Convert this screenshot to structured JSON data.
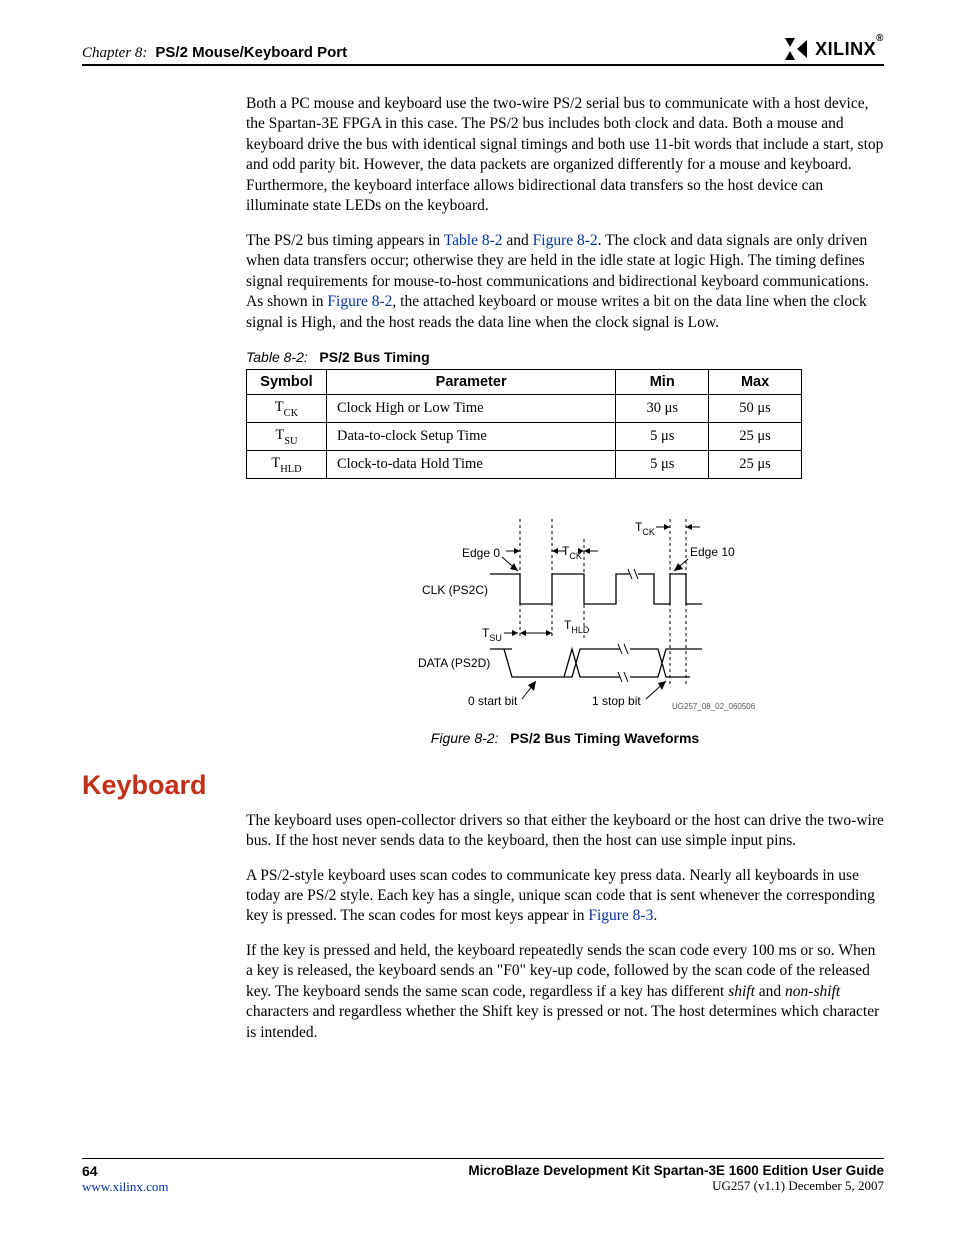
{
  "header": {
    "chapter_label": "Chapter 8:",
    "chapter_title": "PS/2 Mouse/Keyboard Port",
    "logo_text": "XILINX"
  },
  "para1": "Both a PC mouse and keyboard use the two-wire PS/2 serial bus to communicate with a host device, the Spartan-3E FPGA in this case. The PS/2 bus includes both clock and data. Both a mouse and keyboard drive the bus with identical signal timings and both use 11-bit words that include a start, stop and odd parity bit. However, the data packets are organized differently for a mouse and keyboard. Furthermore, the keyboard interface allows bidirectional data transfers so the host device can illuminate state LEDs on the keyboard.",
  "para2_a": "The PS/2 bus timing appears in ",
  "para2_xref1": "Table 8-2",
  "para2_b": " and ",
  "para2_xref2": "Figure 8-2",
  "para2_c": ". The clock and data signals are only driven when data transfers occur; otherwise they are held in the idle state at logic High. The timing defines signal requirements for mouse-to-host communications and bidirectional keyboard communications. As shown in ",
  "para2_xref3": "Figure 8-2",
  "para2_d": ", the attached keyboard or mouse writes a bit on the data line when the clock signal is High, and the host reads the data line when the clock signal is Low.",
  "table": {
    "caption_num": "Table 8-2:",
    "caption_title": "PS/2 Bus Timing",
    "headers": {
      "symbol": "Symbol",
      "parameter": "Parameter",
      "min": "Min",
      "max": "Max"
    },
    "rows": [
      {
        "sym_main": "T",
        "sym_sub": "CK",
        "param": "Clock High or Low Time",
        "min": "30 μs",
        "max": "50 μs"
      },
      {
        "sym_main": "T",
        "sym_sub": "SU",
        "param": "Data-to-clock Setup Time",
        "min": "5 μs",
        "max": "25 μs"
      },
      {
        "sym_main": "T",
        "sym_sub": "HLD",
        "param": "Clock-to-data Hold Time",
        "min": "5 μs",
        "max": "25 μs"
      }
    ]
  },
  "figure": {
    "caption_num": "Figure 8-2:",
    "caption_title": "PS/2 Bus Timing Waveforms",
    "labels": {
      "edge0": "Edge 0",
      "edge10": "Edge 10",
      "clk": "CLK (PS2C)",
      "data": "DATA (PS2D)",
      "tck": "T",
      "tck_sub": "CK",
      "tsu": "T",
      "tsu_sub": "SU",
      "thld": "T",
      "thld_sub": "HLD",
      "startbit": "0 start bit",
      "stopbit": "1 stop bit",
      "diagid": "UG257_08_02_060506"
    }
  },
  "section_heading": "Keyboard",
  "para3": "The keyboard uses open-collector drivers so that either the keyboard or the host can drive the two-wire bus. If the host never sends data to the keyboard, then the host can use simple input pins.",
  "para4_a": "A PS/2-style keyboard uses scan codes to communicate key press data. Nearly all keyboards in use today are PS/2 style. Each key has a single, unique scan code that is sent whenever the corresponding key is pressed. The scan codes for most keys appear in ",
  "para4_xref": "Figure 8-3",
  "para4_b": ".",
  "para5_a": "If the key is pressed and held, the keyboard repeatedly sends the scan code every 100 ms or so. When a key is released, the keyboard sends an \"F0\" key-up code, followed by the scan code of the released key. The keyboard sends the same scan code, regardless if a key has different ",
  "para5_i1": "shift",
  "para5_b": " and ",
  "para5_i2": "non-shift",
  "para5_c": " characters and regardless whether the Shift key is pressed or not. The host determines which character is intended.",
  "footer": {
    "page_num": "64",
    "guide_title": "MicroBlaze Development Kit Spartan-3E 1600 Edition User Guide",
    "url": "www.xilinx.com",
    "version": "UG257 (v1.1) December 5, 2007"
  }
}
